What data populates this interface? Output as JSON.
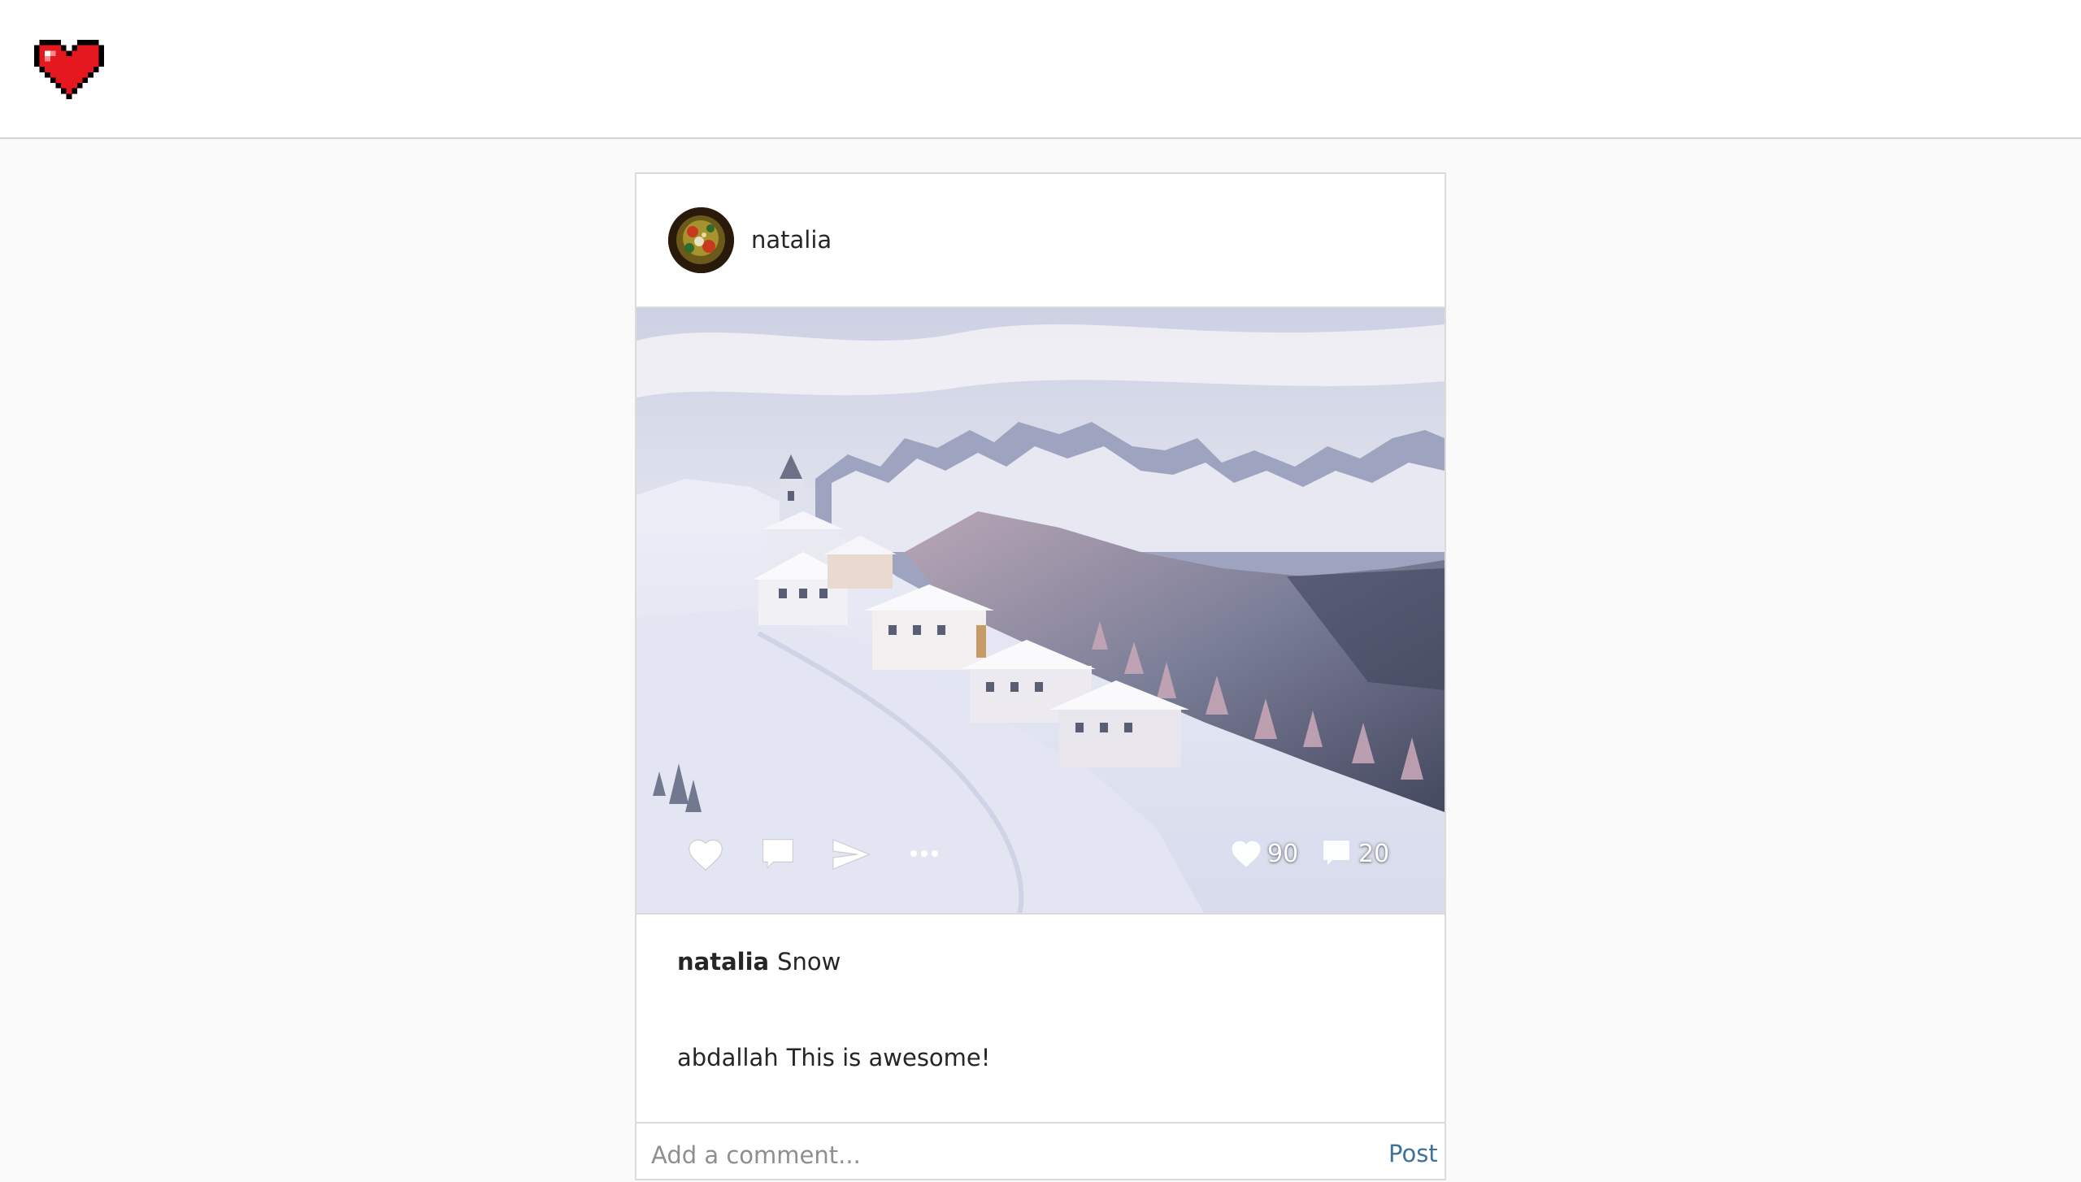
{
  "colors": {
    "logo": "#e5171f",
    "post_link": "#3f729b",
    "border": "#dbdbdb",
    "background": "#fafafa"
  },
  "post": {
    "username": "natalia",
    "photo_icon_names": [
      "heart-icon",
      "comment-icon",
      "send-icon",
      "more-icon"
    ],
    "likes": "90",
    "comments": "20",
    "caption": {
      "user": "natalia",
      "text": "Snow"
    },
    "comment_list": [
      {
        "user": "abdallah",
        "text": "This is awesome!"
      }
    ],
    "add_comment": {
      "placeholder": "Add a comment...",
      "button": "Post"
    }
  }
}
